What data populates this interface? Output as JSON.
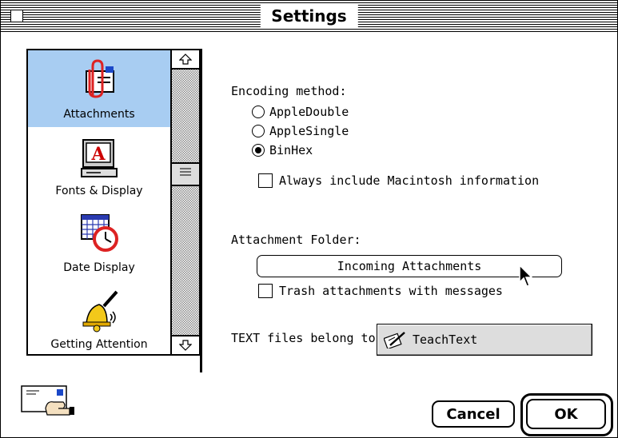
{
  "window": {
    "title": "Settings"
  },
  "sidebar": {
    "items": [
      {
        "label": "Attachments",
        "icon": "attachment-icon",
        "selected": true
      },
      {
        "label": "Fonts & Display",
        "icon": "font-display-icon",
        "selected": false
      },
      {
        "label": "Date Display",
        "icon": "calendar-clock-icon",
        "selected": false
      },
      {
        "label": "Getting Attention",
        "icon": "bell-icon",
        "selected": false
      }
    ]
  },
  "encoding": {
    "label": "Encoding method:",
    "options": [
      {
        "label": "AppleDouble",
        "selected": false
      },
      {
        "label": "AppleSingle",
        "selected": false
      },
      {
        "label": "BinHex",
        "selected": true
      }
    ],
    "mac_info_label": "Always include Macintosh information",
    "mac_info_checked": false
  },
  "folder": {
    "label": "Attachment Folder:",
    "button_label": "Incoming Attachments",
    "trash_label": "Trash attachments with messages",
    "trash_checked": false
  },
  "text_files": {
    "label": "TEXT files belong to:",
    "app_name": "TeachText"
  },
  "buttons": {
    "cancel": "Cancel",
    "ok": "OK"
  },
  "colors": {
    "selection": "#a8cdf2"
  }
}
